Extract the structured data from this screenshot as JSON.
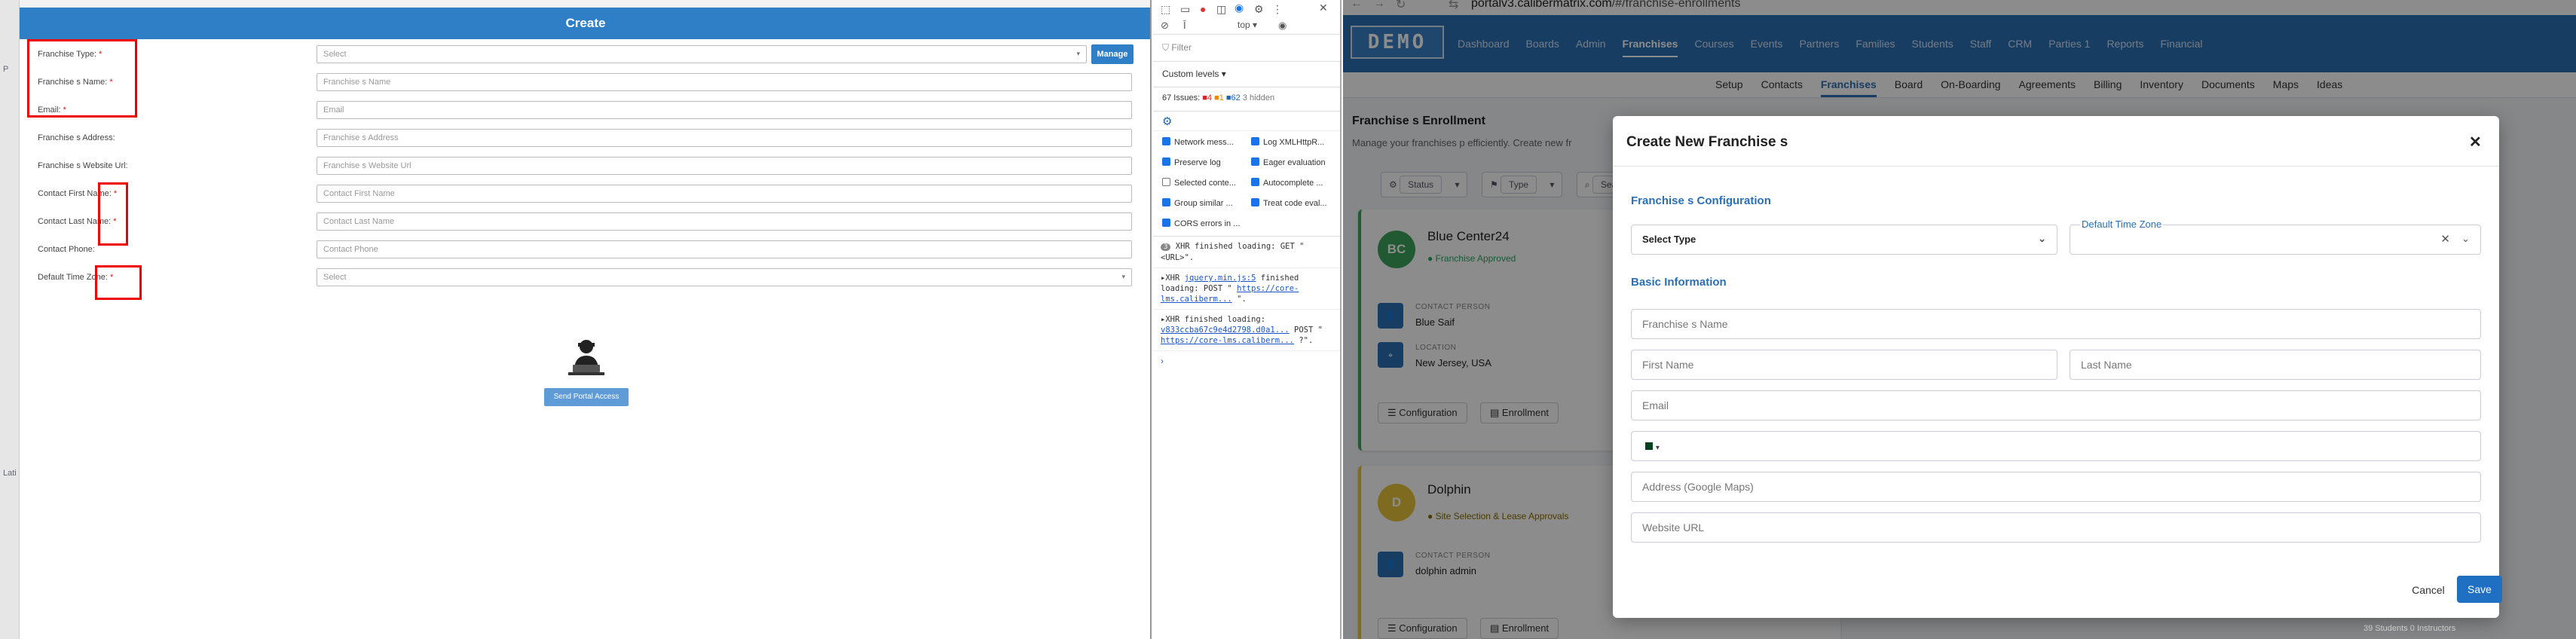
{
  "legacy_form": {
    "title": "Create",
    "manage_label": "Manage",
    "send_portal_label": "Send Portal Access",
    "gutter": [
      "P",
      "Lati"
    ],
    "fields": [
      {
        "label": "Franchise Type:",
        "required": true,
        "placeholder": "Select",
        "type": "select"
      },
      {
        "label": "Franchise s Name:",
        "required": true,
        "placeholder": "Franchise s Name"
      },
      {
        "label": "Email:",
        "required": true,
        "placeholder": "Email"
      },
      {
        "label": "Franchise s Address:",
        "required": false,
        "placeholder": "Franchise s Address"
      },
      {
        "label": "Franchise s Website Url:",
        "required": false,
        "placeholder": "Franchise s Website Url"
      },
      {
        "label": "Contact First Name:",
        "required": true,
        "placeholder": "Contact First Name"
      },
      {
        "label": "Contact Last Name:",
        "required": true,
        "placeholder": "Contact Last Name"
      },
      {
        "label": "Contact Phone:",
        "required": false,
        "placeholder": "Contact Phone"
      },
      {
        "label": "Default Time Zone:",
        "required": true,
        "placeholder": "Select",
        "type": "select"
      }
    ]
  },
  "devtools": {
    "context": "top ▾",
    "filter_placeholder": "Filter",
    "levels_label": "Custom levels ▾",
    "issues_text": "67 Issues:",
    "issues_red": "4",
    "issues_orange": "1",
    "issues_blue": "62",
    "hidden_text": "3 hidden",
    "checkboxes": [
      {
        "label": "Network mess...",
        "checked": true
      },
      {
        "label": "Log XMLHttpR...",
        "checked": true
      },
      {
        "label": "Preserve log",
        "checked": true
      },
      {
        "label": "Eager evaluation",
        "checked": true
      },
      {
        "label": "Selected conte...",
        "checked": false
      },
      {
        "label": "Autocomplete ...",
        "checked": true
      },
      {
        "label": "Group similar ...",
        "checked": true
      },
      {
        "label": "Treat code eval...",
        "checked": true
      },
      {
        "label": "CORS errors in ...",
        "checked": true
      }
    ],
    "logs": [
      {
        "badge": "3",
        "text": "XHR finished loading: GET \"<URL>\"."
      },
      {
        "prefix": "▸XHR",
        "link": "jquery.min.js:5",
        "text": "finished loading: POST \"",
        "url": "https://core-lms.caliberm...",
        "tail": "\"."
      },
      {
        "prefix": "▸XHR finished loading:",
        "link": "v833ccba67c9e4d2798.d0a1...",
        "text": "POST \"",
        "url": "https://core-lms.caliberm...",
        "tail": "?\"."
      }
    ]
  },
  "browser": {
    "url_host": "portalv3.calibermatrix.com",
    "url_path": "/#/franchise-enrollments"
  },
  "app": {
    "logo": "DEMO",
    "main_menu": [
      "Dashboard",
      "Boards",
      "Admin",
      "Franchises",
      "Courses",
      "Events",
      "Partners",
      "Families",
      "Students",
      "Staff",
      "CRM",
      "Parties 1",
      "Reports",
      "Financial"
    ],
    "main_menu_active": "Franchises",
    "sub_menu": [
      "Setup",
      "Contacts",
      "Franchises",
      "Board",
      "On-Boarding",
      "Agreements",
      "Billing",
      "Inventory",
      "Documents",
      "Maps",
      "Ideas"
    ],
    "sub_menu_active": "Franchises",
    "page_title": "Franchise s Enrollment",
    "page_subtitle": "Manage your franchises p efficiently. Create new fr",
    "filters": [
      "Status",
      "Type",
      "Search franc"
    ],
    "cards": [
      {
        "initials": "BC",
        "name": "Blue Center24",
        "status": "Franchise Approved",
        "contact_label": "CONTACT PERSON",
        "contact": "Blue Saif",
        "location_label": "LOCATION",
        "location": "New Jersey, USA",
        "btn1": "Configuration",
        "btn2": "Enrollment",
        "avatar_color": "#3ca55c"
      },
      {
        "initials": "D",
        "name": "Dolphin",
        "status": "Site Selection & Lease Approvals",
        "contact_label": "CONTACT PERSON",
        "contact": "dolphin admin",
        "btn1": "Configuration",
        "btn2": "Enrollment",
        "avatar_color": "#e6c43a"
      }
    ],
    "stats_text": "39 Students    0 Instructors"
  },
  "dialog": {
    "title": "Create New Franchise s",
    "section_config": "Franchise s Configuration",
    "type_placeholder": "Select Type",
    "timezone_label": "Default Time Zone",
    "section_basic": "Basic Information",
    "name_placeholder": "Franchise s Name",
    "first_name_placeholder": "First Name",
    "last_name_placeholder": "Last Name",
    "email_placeholder": "Email",
    "phone_prefix": "▾",
    "address_placeholder": "Address (Google Maps)",
    "website_placeholder": "Website URL",
    "cancel_label": "Cancel",
    "save_label": "Save"
  }
}
